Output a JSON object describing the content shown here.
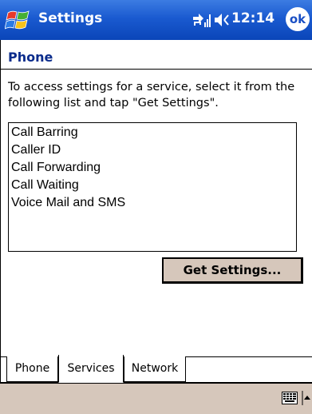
{
  "titlebar": {
    "title": "Settings",
    "time": "12:14",
    "ok_label": "ok",
    "icons": [
      "windows-start-icon",
      "connectivity-icon",
      "volume-icon"
    ]
  },
  "page": {
    "header": "Phone",
    "instructions": "To access settings for a service, select it from the following list and tap \"Get Settings\"."
  },
  "service_list": {
    "items": [
      "Call Barring",
      "Caller ID",
      "Call Forwarding",
      "Call Waiting",
      "Voice Mail and SMS"
    ]
  },
  "buttons": {
    "get_settings": "Get Settings..."
  },
  "tabs": [
    {
      "label": "Phone",
      "active": false
    },
    {
      "label": "Services",
      "active": true
    },
    {
      "label": "Network",
      "active": false
    }
  ],
  "command_bar": {
    "icons": [
      "keyboard-icon",
      "sip-arrow-icon"
    ]
  },
  "colors": {
    "titlebar": "#1a5ad0",
    "header_text": "#0b2c8c",
    "button_face": "#d6c7bb",
    "command_bar": "#d6c7bb"
  }
}
